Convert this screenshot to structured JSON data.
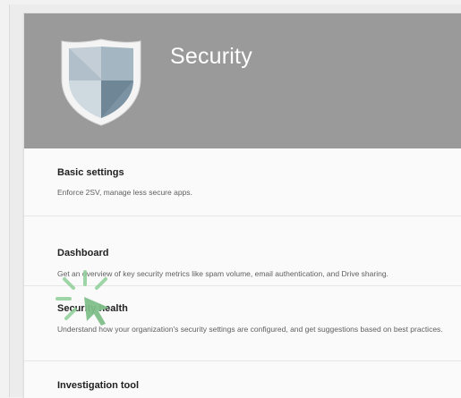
{
  "header": {
    "title": "Security",
    "background_color": "#9a9a9a",
    "icon": "shield-icon"
  },
  "sections": [
    {
      "title": "Basic settings",
      "description": "Enforce 2SV, manage less secure apps."
    },
    {
      "title": "Dashboard",
      "description": "Get an overview of key security metrics like spam volume, email authentication, and Drive sharing."
    },
    {
      "title": "Security health",
      "description": "Understand how your organization's security settings are configured, and get suggestions based on best practices."
    },
    {
      "title": "Investigation tool",
      "description": ""
    }
  ],
  "cursor": {
    "icon": "click-highlight-icon",
    "color": "#7fbf8a"
  }
}
